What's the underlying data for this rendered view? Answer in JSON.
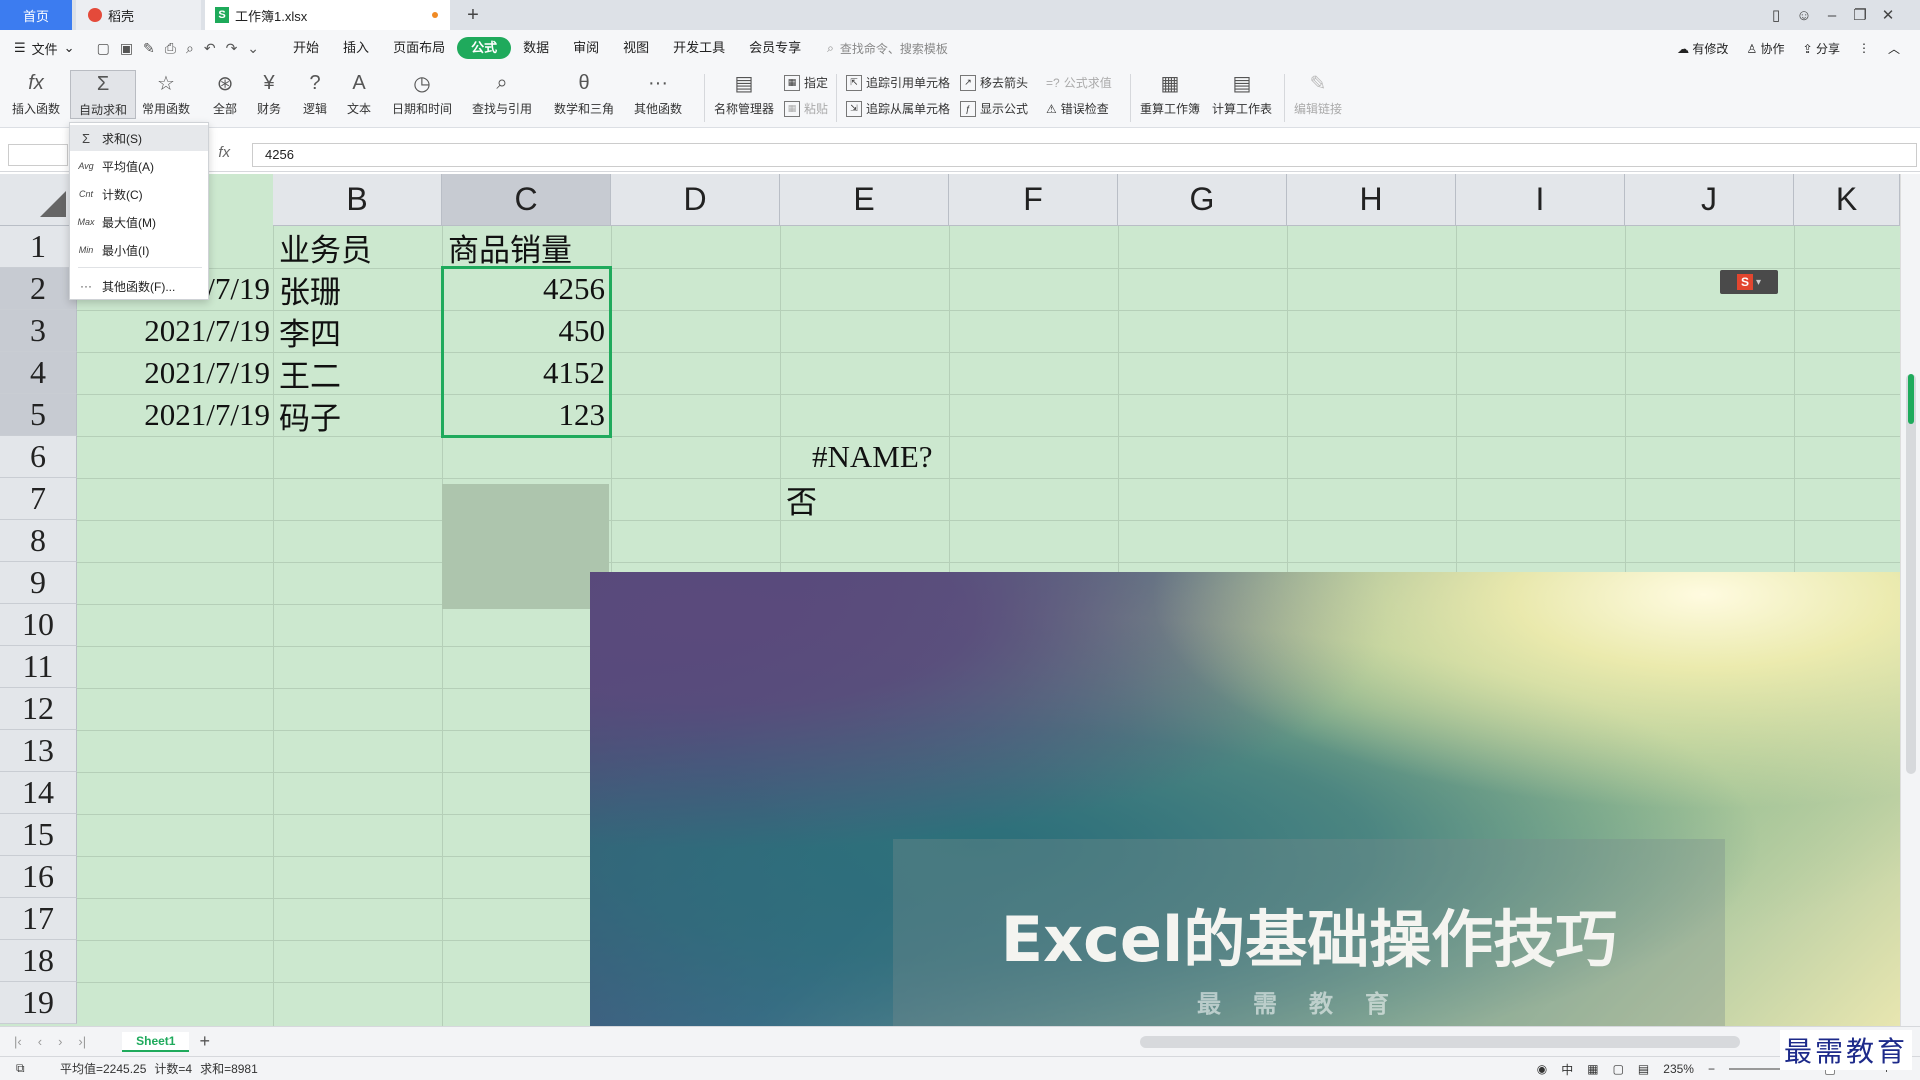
{
  "tabbar": {
    "home": "首页",
    "docer": "稻壳",
    "file": "工作簿1.xlsx",
    "add": "+"
  },
  "menubar": {
    "file_menu": "文件",
    "items": [
      "开始",
      "插入",
      "页面布局",
      "公式",
      "数据",
      "审阅",
      "视图",
      "开发工具",
      "会员专享"
    ],
    "active": "公式",
    "search_placeholder": "查找命令、搜索模板",
    "right": {
      "modify": "有修改",
      "collab": "协作",
      "share": "分享"
    }
  },
  "ribbon": {
    "insert_func": "插入函数",
    "autosum": "自动求和",
    "common": "常用函数",
    "all": "全部",
    "finance": "财务",
    "logic": "逻辑",
    "text": "文本",
    "datetime": "日期和时间",
    "lookup": "查找与引用",
    "math": "数学和三角",
    "other": "其他函数",
    "name_mgr": "名称管理器",
    "define": "指定",
    "paste": "粘贴",
    "trace_prec": "追踪引用单元格",
    "trace_dep": "追踪从属单元格",
    "remove_arrows": "移去箭头",
    "show_formula": "显示公式",
    "eval_formula": "公式求值",
    "error_check": "错误检查",
    "recalc_wb": "重算工作簿",
    "calc_sheet": "计算工作表",
    "edit_links": "编辑链接"
  },
  "dropdown": {
    "items": [
      {
        "abbr": "Σ",
        "label": "求和(S)"
      },
      {
        "abbr": "Avg",
        "label": "平均值(A)"
      },
      {
        "abbr": "Cnt",
        "label": "计数(C)"
      },
      {
        "abbr": "Max",
        "label": "最大值(M)"
      },
      {
        "abbr": "Min",
        "label": "最小值(I)"
      },
      {
        "abbr": "···",
        "label": "其他函数(F)..."
      }
    ]
  },
  "formula_bar": {
    "fx": "fx",
    "value": "4256"
  },
  "grid": {
    "columns": [
      "B",
      "C",
      "D",
      "E",
      "F",
      "G",
      "H",
      "I",
      "J",
      "K"
    ],
    "rows": [
      "1",
      "2",
      "3",
      "4",
      "5",
      "6",
      "7",
      "8",
      "9",
      "10",
      "11",
      "12",
      "13",
      "14",
      "15",
      "16",
      "17",
      "18",
      "19"
    ],
    "cells": {
      "B1": "业务员",
      "C1": "商品销量",
      "A2": "2021/7/19",
      "B2": "张珊",
      "C2": "4256",
      "A3": "2021/7/19",
      "B3": "李四",
      "C3": "450",
      "A4": "2021/7/19",
      "B4": "王二",
      "C4": "4152",
      "A5": "2021/7/19",
      "B5": "码子",
      "C5": "123",
      "E6": "#NAME?",
      "E7": "否"
    }
  },
  "banner": {
    "title": "Excel的基础操作技巧",
    "subtitle": "最需教育"
  },
  "sheetbar": {
    "sheet": "Sheet1"
  },
  "statusbar": {
    "average": "平均值=2245.25",
    "count": "计数=4",
    "sum": "求和=8981",
    "zoom": "235%"
  },
  "watermark": "最需教育",
  "colors": {
    "accent": "#1faa5c",
    "grid_bg": "#cce8cf",
    "tab_home": "#3c7cf0"
  }
}
